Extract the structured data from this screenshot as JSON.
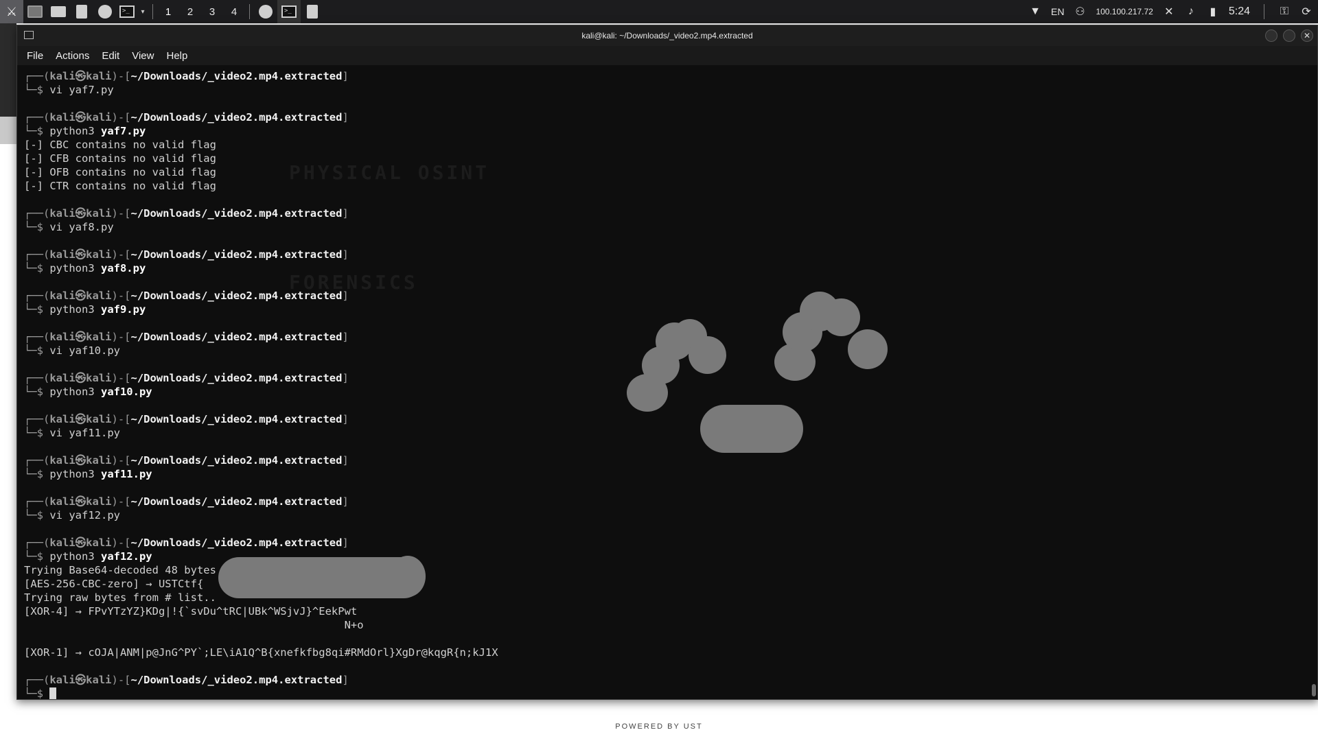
{
  "panel": {
    "workspaces": [
      "1",
      "2",
      "3",
      "4"
    ],
    "active_workspace": "1",
    "tray": {
      "keyboard_layout": "EN",
      "ip_address": "100.100.217.72",
      "clock": "5:24"
    }
  },
  "window": {
    "title": "kali@kali: ~/Downloads/_video2.mp4.extracted",
    "menu": [
      "File",
      "Actions",
      "Edit",
      "View",
      "Help"
    ]
  },
  "terminal": {
    "prompt": {
      "user": "kali",
      "at": "㉿",
      "host": "kali",
      "path": "~/Downloads/_video2.mp4.extracted",
      "symbol": "$"
    },
    "blocks": [
      {
        "cmd": "vi",
        "arg": "yaf7.py",
        "bold": false,
        "output": []
      },
      {
        "cmd": "python3",
        "arg": "yaf7.py",
        "bold": true,
        "output": [
          "[-] CBC contains no valid flag",
          "[-] CFB contains no valid flag",
          "[-] OFB contains no valid flag",
          "[-] CTR contains no valid flag"
        ]
      },
      {
        "cmd": "vi",
        "arg": "yaf8.py",
        "bold": false,
        "output": []
      },
      {
        "cmd": "python3",
        "arg": "yaf8.py",
        "bold": true,
        "output": []
      },
      {
        "cmd": "python3",
        "arg": "yaf9.py",
        "bold": true,
        "output": []
      },
      {
        "cmd": "vi",
        "arg": "yaf10.py",
        "bold": false,
        "output": []
      },
      {
        "cmd": "python3",
        "arg": "yaf10.py",
        "bold": true,
        "output": []
      },
      {
        "cmd": "vi",
        "arg": "yaf11.py",
        "bold": false,
        "output": []
      },
      {
        "cmd": "python3",
        "arg": "yaf11.py",
        "bold": true,
        "output": []
      },
      {
        "cmd": "vi",
        "arg": "yaf12.py",
        "bold": false,
        "output": []
      },
      {
        "cmd": "python3",
        "arg": "yaf12.py",
        "bold": true,
        "output": [
          "Trying Base64-decoded 48 bytes",
          "[AES-256-CBC-zero] → USTCtf{                         59e}",
          "Trying raw bytes from # list..",
          "[XOR-4] → FPvYTzYZ}KDg|!{`svDu^tRC|UBk^WSjvJ}^EekPwt",
          "                                                  N+o",
          "",
          "[XOR-1] → cOJA|ANM|p@JnG^PY`;LE\\iA1Q^B{xnefkfbg8qi#RMdOrl}XgDr@kqgR{n;kJ1X"
        ]
      }
    ]
  },
  "background_ghost": {
    "heading_1": "PHYSICAL OSINT",
    "heading_2": "FORENSICS"
  },
  "footer": "POWERED BY UST"
}
